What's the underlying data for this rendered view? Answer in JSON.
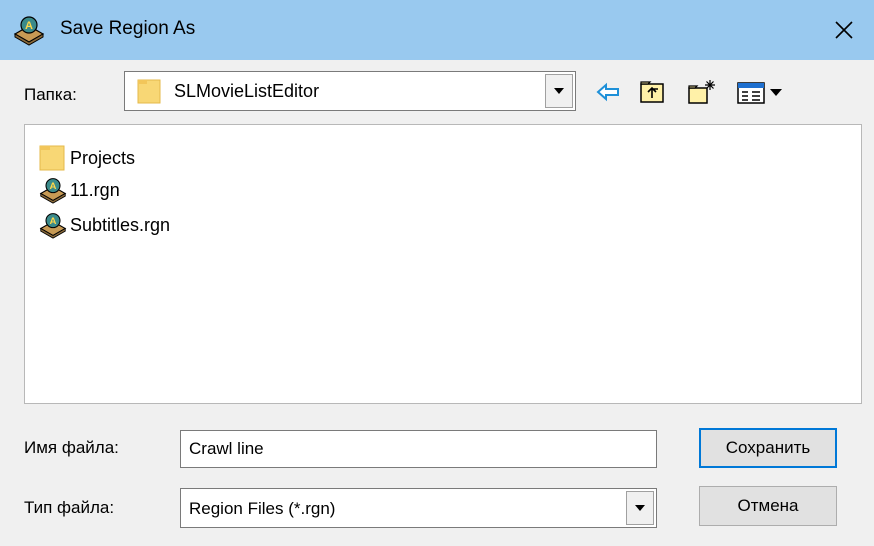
{
  "window": {
    "title": "Save Region As"
  },
  "folder": {
    "label": "Папка:",
    "current": "SLMovieListEditor"
  },
  "toolbar": [
    "back-icon",
    "up-folder-icon",
    "new-folder-icon",
    "view-menu-icon"
  ],
  "files": [
    {
      "name": "Projects",
      "icon": "folder-icon"
    },
    {
      "name": "11.rgn",
      "icon": "region-file-icon"
    },
    {
      "name": "Subtitles.rgn",
      "icon": "region-file-icon"
    }
  ],
  "filename": {
    "label": "Имя файла:",
    "value": "Crawl line"
  },
  "filetype": {
    "label": "Тип файла:",
    "value": "Region Files (*.rgn)"
  },
  "buttons": {
    "save": "Сохранить",
    "cancel": "Отмена"
  },
  "colors": {
    "titlebar": "#99c9ef",
    "selection": "#0078d7"
  }
}
